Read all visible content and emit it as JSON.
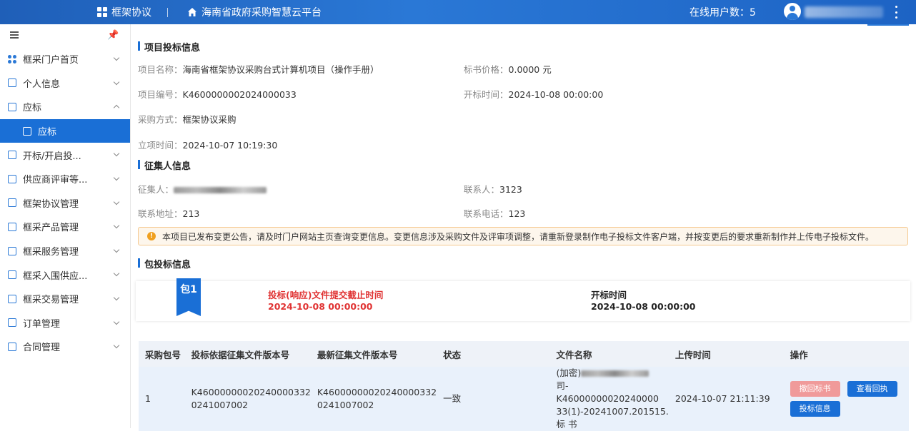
{
  "header": {
    "brand": "框架协议",
    "platform": "海南省政府采购智慧云平台",
    "online_users": "在线用户数：5"
  },
  "sidebar": {
    "items": [
      {
        "label": "框采门户首页"
      },
      {
        "label": "个人信息"
      },
      {
        "label": "应标"
      },
      {
        "label": "应标"
      },
      {
        "label": "开标/开启投..."
      },
      {
        "label": "供应商评审等..."
      },
      {
        "label": "框架协议管理"
      },
      {
        "label": "框采产品管理"
      },
      {
        "label": "框采服务管理"
      },
      {
        "label": "框采入围供应..."
      },
      {
        "label": "框采交易管理"
      },
      {
        "label": "订单管理"
      },
      {
        "label": "合同管理"
      }
    ]
  },
  "project": {
    "title": "项目投标信息",
    "name_label": "项目名称：",
    "name_value": "海南省框架协议采购台式计算机项目（操作手册）",
    "price_label": "标书价格：",
    "price_value": "0.0000 元",
    "code_label": "项目编号：",
    "code_value": "K4600000002024000033",
    "open_label": "开标时间：",
    "open_value": "2024-10-08 00:00:00",
    "method_label": "采购方式：",
    "method_value": "框架协议采购",
    "setup_label": "立项时间：",
    "setup_value": "2024-10-07 10:19:30"
  },
  "collector": {
    "title": "征集人信息",
    "collector_label": "征集人：",
    "contact_label": "联系人：",
    "contact_value": "3123",
    "address_label": "联系地址：",
    "address_value": "213",
    "phone_label": "联系电话：",
    "phone_value": "123"
  },
  "notice": "本项目已发布变更公告，请及时门户网站主页查询变更信息。变更信息涉及采购文件及评审项调整，请重新登录制作电子投标文件客户端，并按变更后的要求重新制作并上传电子投标文件。",
  "package": {
    "title": "包投标信息",
    "badge": "包1",
    "deadline_label": "投标(响应)文件提交截止时间",
    "deadline_value": "2024-10-08 00:00:00",
    "open_label": "开标时间",
    "open_value": "2024-10-08 00:00:00"
  },
  "table": {
    "headers": [
      "采购包号",
      "投标依据征集文件版本号",
      "最新征集文件版本号",
      "状态",
      "文件名称",
      "上传时间",
      "操作"
    ],
    "row": {
      "pkg": "1",
      "basis_version": "K46000000020240000332 0241007002",
      "latest_version": "K46000000020240000332 0241007002",
      "status": "一致",
      "file_prefix": "(加密)",
      "file_rest": "司-K46000000020240000 33(1)-20241007.201515.标 书",
      "upload_time": "2024-10-07 21:11:39",
      "actions": {
        "withdraw": "撤回标书",
        "receipt": "查看回执",
        "info": "投标信息"
      }
    }
  },
  "colors": {
    "primary": "#1a6fd6",
    "deadline": "#e03333",
    "notice_bg": "#fdf6ec"
  }
}
